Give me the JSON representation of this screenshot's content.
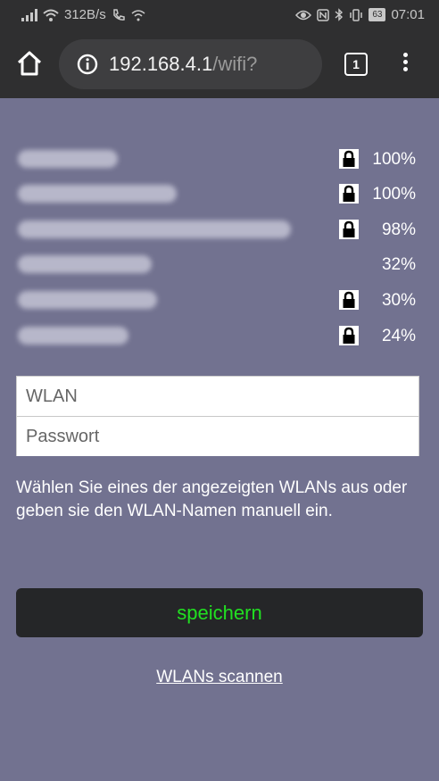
{
  "status": {
    "speed": "312B/s",
    "battery": "63",
    "time": "07:01"
  },
  "browser": {
    "url_host": "192.168.4.1",
    "url_path": "/wifi?",
    "tab_count": "1"
  },
  "networks": [
    {
      "locked": true,
      "signal": "100%"
    },
    {
      "locked": true,
      "signal": "100%"
    },
    {
      "locked": true,
      "signal": "98%"
    },
    {
      "locked": false,
      "signal": "32%"
    },
    {
      "locked": true,
      "signal": "30%"
    },
    {
      "locked": true,
      "signal": "24%"
    }
  ],
  "form": {
    "ssid_placeholder": "WLAN",
    "password_placeholder": "Passwort",
    "help_text": "Wählen Sie eines der angezeigten WLANs aus oder geben sie den WLAN-Namen manuell ein.",
    "save_label": "speichern",
    "scan_label": "WLANs scannen"
  },
  "colors": {
    "background": "#727290",
    "button_bg": "#252628",
    "button_text": "#21e021"
  }
}
